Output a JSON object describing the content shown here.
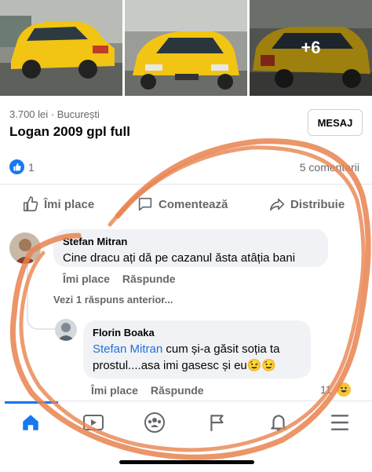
{
  "photos": {
    "more_label": "+6"
  },
  "listing": {
    "price_location": "3.700 lei · București",
    "title": "Logan 2009 gpl full",
    "message_button": "MESAJ"
  },
  "reactions": {
    "count": "1",
    "comments": "5 comentarii"
  },
  "actions": {
    "like": "Îmi place",
    "comment": "Comentează",
    "share": "Distribuie"
  },
  "comments": [
    {
      "author": "Stefan Mitran",
      "text": "Cine dracu ați dă pe cazanul ăsta atâția bani",
      "like": "Îmi place",
      "reply": "Răspunde"
    }
  ],
  "previous_replies": "Vezi 1 răspuns anterior...",
  "reply": {
    "author": "Florin Boaka",
    "mention": "Stefan Mitran",
    "text_after_mention": " cum și-a găsit soția ta prostul....asa imi gasesc și eu😉😉",
    "like": "Îmi place",
    "reply": "Răspunde",
    "reaction_count": "11"
  },
  "colors": {
    "accent": "#1877f2",
    "annotation": "#e8834f",
    "taxi_yellow": "#f2c514"
  },
  "nav": {
    "items": [
      "home-icon",
      "video-icon",
      "groups-icon",
      "pages-flag-icon",
      "notifications-bell-icon",
      "menu-icon"
    ]
  }
}
